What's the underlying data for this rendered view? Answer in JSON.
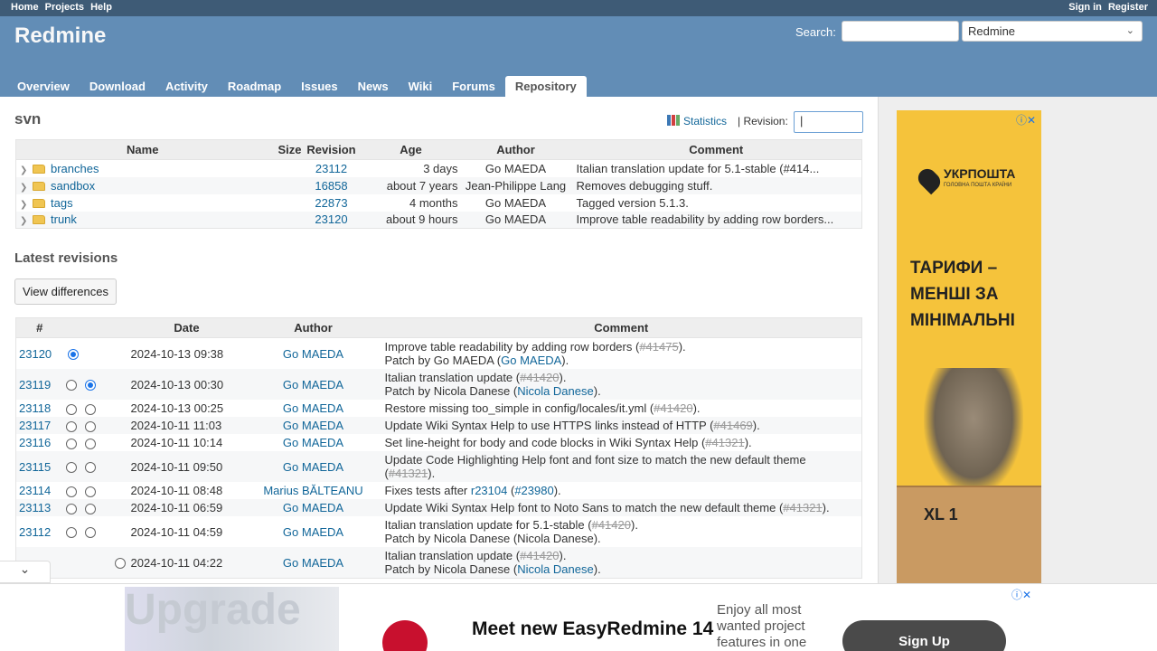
{
  "top_menu": {
    "home": "Home",
    "projects": "Projects",
    "help": "Help",
    "sign_in": "Sign in",
    "register": "Register"
  },
  "header": {
    "title": "Redmine",
    "search_label": "Search:",
    "project_select": "Redmine"
  },
  "main_menu": {
    "tabs": [
      "Overview",
      "Download",
      "Activity",
      "Roadmap",
      "Issues",
      "News",
      "Wiki",
      "Forums",
      "Repository"
    ],
    "selected": "Repository"
  },
  "repository": {
    "title": "svn",
    "statistics": "Statistics",
    "revision_label": "| Revision:",
    "revision_value": "|",
    "columns": [
      "Name",
      "Size",
      "Revision",
      "Age",
      "Author",
      "Comment"
    ],
    "entries": [
      {
        "name": "branches",
        "size": "",
        "revision": "23112",
        "age": "3 days",
        "author": "Go MAEDA",
        "comment": "Italian translation update for 5.1-stable (#414..."
      },
      {
        "name": "sandbox",
        "size": "",
        "revision": "16858",
        "age": "about 7 years",
        "author": "Jean-Philippe Lang",
        "comment": "Removes debugging stuff."
      },
      {
        "name": "tags",
        "size": "",
        "revision": "22873",
        "age": "4 months",
        "author": "Go MAEDA",
        "comment": "Tagged version 5.1.3."
      },
      {
        "name": "trunk",
        "size": "",
        "revision": "23120",
        "age": "about 9 hours",
        "author": "Go MAEDA",
        "comment": "Improve table readability by adding row borders..."
      }
    ]
  },
  "latest": {
    "title": "Latest revisions",
    "view_differences": "View differences",
    "columns": [
      "#",
      "Date",
      "Author",
      "Comment"
    ],
    "revisions": [
      {
        "id": "23120",
        "date": "2024-10-13 09:38",
        "author": "Go MAEDA",
        "line1": "Improve table readability by adding row borders (",
        "ref": "#41475",
        "line1_end": ").",
        "line2": "Patch by Go MAEDA (",
        "link2": "Go MAEDA",
        "line2_end": ")."
      },
      {
        "id": "23119",
        "date": "2024-10-13 00:30",
        "author": "Go MAEDA",
        "line1": "Italian translation update (",
        "ref": "#41420",
        "line1_end": ").",
        "line2": "Patch by Nicola Danese (",
        "link2": "Nicola Danese",
        "line2_end": ")."
      },
      {
        "id": "23118",
        "date": "2024-10-13 00:25",
        "author": "Go MAEDA",
        "line1": "Restore missing too_simple in config/locales/it.yml (",
        "ref": "#41420",
        "line1_end": ")."
      },
      {
        "id": "23117",
        "date": "2024-10-11 11:03",
        "author": "Go MAEDA",
        "line1": "Update Wiki Syntax Help to use HTTPS links instead of HTTP (",
        "ref": "#41469",
        "line1_end": ")."
      },
      {
        "id": "23116",
        "date": "2024-10-11 10:14",
        "author": "Go MAEDA",
        "line1": "Set line-height for body and code blocks in Wiki Syntax Help (",
        "ref": "#41321",
        "line1_end": ")."
      },
      {
        "id": "23115",
        "date": "2024-10-11 09:50",
        "author": "Go MAEDA",
        "line1": "Update Code Highlighting Help font and font size to match the new default theme",
        "line2": "(",
        "ref2": "#41321",
        "line2_end": ")."
      },
      {
        "id": "23114",
        "date": "2024-10-11 08:48",
        "author": "Marius BĂLTEANU",
        "line1": "Fixes tests after ",
        "link1": "r23104",
        "line1_mid": " (",
        "link1b": "#23980",
        "line1_end": ")."
      },
      {
        "id": "23113",
        "date": "2024-10-11 06:59",
        "author": "Go MAEDA",
        "line1": "Update Wiki Syntax Help font to Noto Sans to match the new default theme (",
        "ref": "#41321",
        "line1_end": ")."
      },
      {
        "id": "23112",
        "date": "2024-10-11 04:59",
        "author": "Go MAEDA",
        "line1": "Italian translation update for 5.1-stable (",
        "ref": "#41420",
        "line1_end": ").",
        "line2": "Patch by Nicola Danese (Nicola Danese)."
      },
      {
        "id": "",
        "date": "2024-10-11 04:22",
        "author": "Go MAEDA",
        "line1": "Italian translation update (",
        "ref": "#41420",
        "line1_end": ").",
        "line2": "Patch by Nicola Danese (",
        "link2": "Nicola Danese",
        "line2_end": ")."
      }
    ]
  },
  "sidebar_ad": {
    "brand": "УКРПОШТА",
    "brand_sub": "ГОЛОВНА ПОШТА КРАЇНИ",
    "headline": "ТАРИФИ – МЕНШІ ЗА МІНІМАЛЬНІ",
    "box_label": "XL 1"
  },
  "bottom_ad": {
    "photo_text": "Upgrade",
    "headline": "Meet new EasyRedmine 14",
    "subtext": "Enjoy all most wanted project features in one",
    "signup": "Sign Up"
  }
}
